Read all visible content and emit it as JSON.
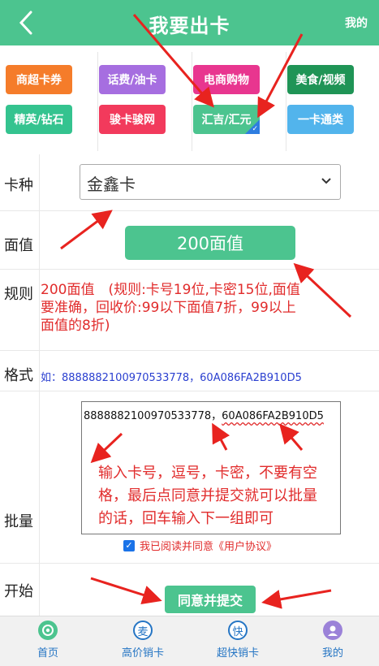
{
  "header": {
    "title": "我要出卡",
    "right_link": "我的"
  },
  "categories": [
    {
      "label": "商超卡券",
      "color": "#f57c2a"
    },
    {
      "label": "话费/油卡",
      "color": "#a66ee0"
    },
    {
      "label": "电商购物",
      "color": "#e8368f"
    },
    {
      "label": "美食/视频",
      "color": "#1f9456"
    },
    {
      "label": "精英/钻石",
      "color": "#34c38f"
    },
    {
      "label": "骏卡骏网",
      "color": "#f23a5c"
    },
    {
      "label": "汇吉/汇元",
      "color": "#4cc48f",
      "selected": true
    },
    {
      "label": "一卡通类",
      "color": "#52b4ec"
    }
  ],
  "form": {
    "card_type": {
      "label": "卡种",
      "value": "金鑫卡"
    },
    "face_value": {
      "label": "面值",
      "value": "200面值"
    },
    "rule": {
      "label": "规则",
      "text": "200面值　(规则:卡号19位,卡密15位,面值要准确，回收价:99以下面值7折，99以上面值的8折)"
    },
    "format": {
      "label": "格式",
      "text": "如：8888882100970533778，60A086FA2B910D5"
    },
    "batch": {
      "label": "批量",
      "card_no": "8888882100970533778，",
      "card_pwd": "60A086FA2B910D5",
      "hint": "输入卡号，逗号，卡密，不要有空格，最后点同意并提交就可以批量的话，回车输入下一组即可",
      "agree_text": "我已阅读并同意《用户协议》",
      "agree_checked": true
    },
    "start": {
      "label": "开始",
      "submit": "同意并提交"
    }
  },
  "tabbar": [
    {
      "label": "首页",
      "icon": "home-icon",
      "color": "#4cc48f",
      "glyph": "◉"
    },
    {
      "label": "高价销卡",
      "icon": "mai-icon",
      "color": "#ffffff",
      "glyph": "麦"
    },
    {
      "label": "超快销卡",
      "icon": "kuai-icon",
      "color": "#ffffff",
      "glyph": "快"
    },
    {
      "label": "我的",
      "icon": "user-icon",
      "color": "#9b82d8",
      "glyph": "●"
    }
  ]
}
